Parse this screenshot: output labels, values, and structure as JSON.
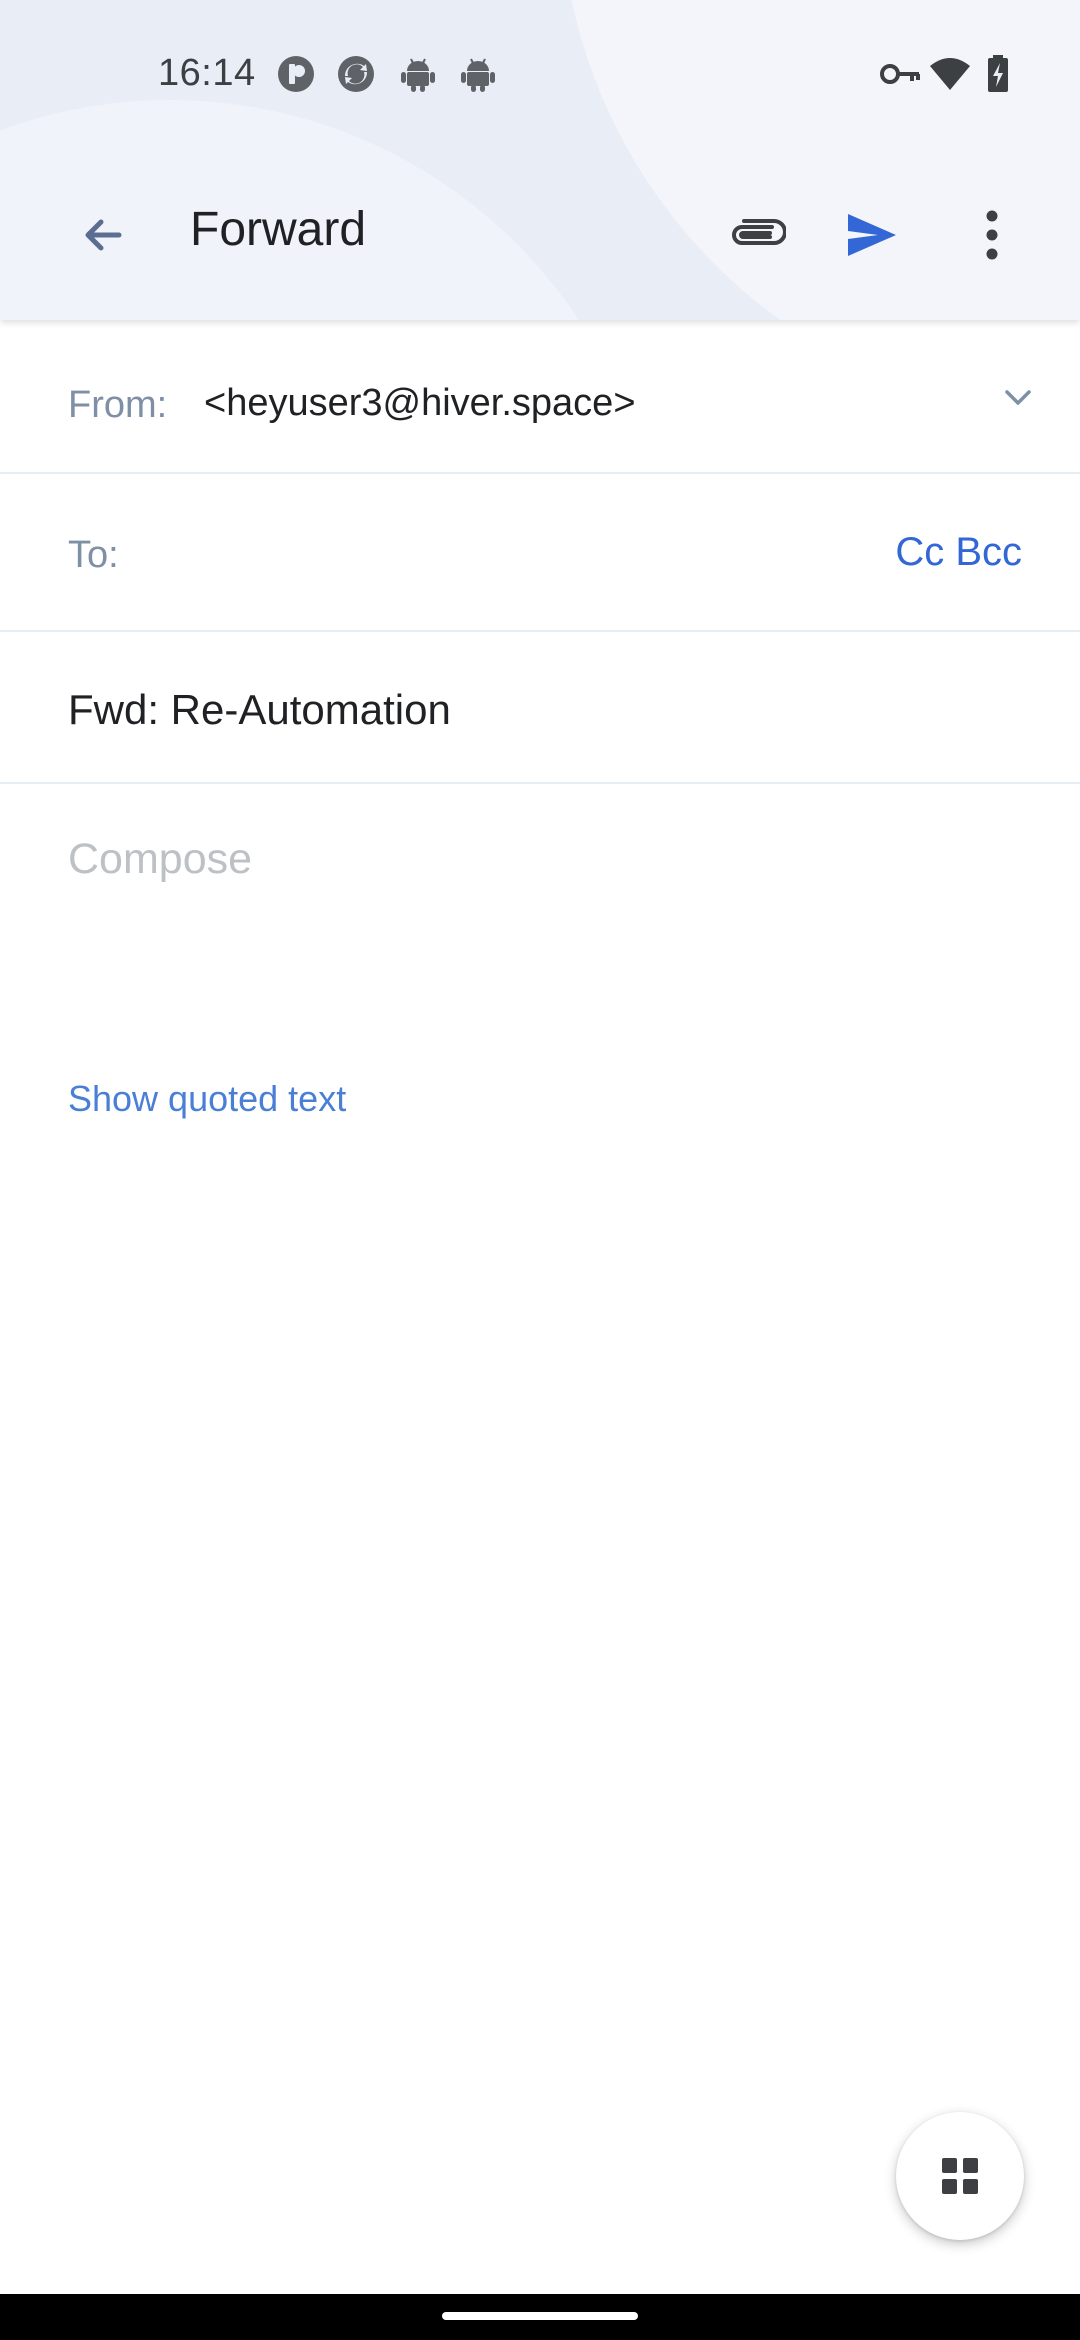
{
  "status_bar": {
    "time": "16:14",
    "left_icons": [
      "app-notification-icon",
      "sync-app-icon",
      "android-icon",
      "android-icon"
    ],
    "right_icons": [
      "vpn-key-icon",
      "wifi-icon",
      "battery-charging-icon"
    ]
  },
  "toolbar": {
    "title": "Forward",
    "back_icon": "arrow-back-icon",
    "attach_icon": "paperclip-icon",
    "send_icon": "send-icon",
    "more_icon": "more-vert-icon"
  },
  "from": {
    "label": "From:",
    "value": "<heyuser3@hiver.space>"
  },
  "to": {
    "label": "To:",
    "value": "",
    "cc_bcc": "Cc Bcc"
  },
  "subject": {
    "value": "Fwd: Re-Automation"
  },
  "compose": {
    "placeholder": "Compose",
    "value": ""
  },
  "quoted_text_link": "Show quoted text",
  "fab": {
    "icon": "apps-grid-icon"
  },
  "colors": {
    "accent": "#3367d6",
    "link": "#4a7fd6",
    "header_bg": "#e9edf6",
    "label": "#7f8fa6"
  }
}
